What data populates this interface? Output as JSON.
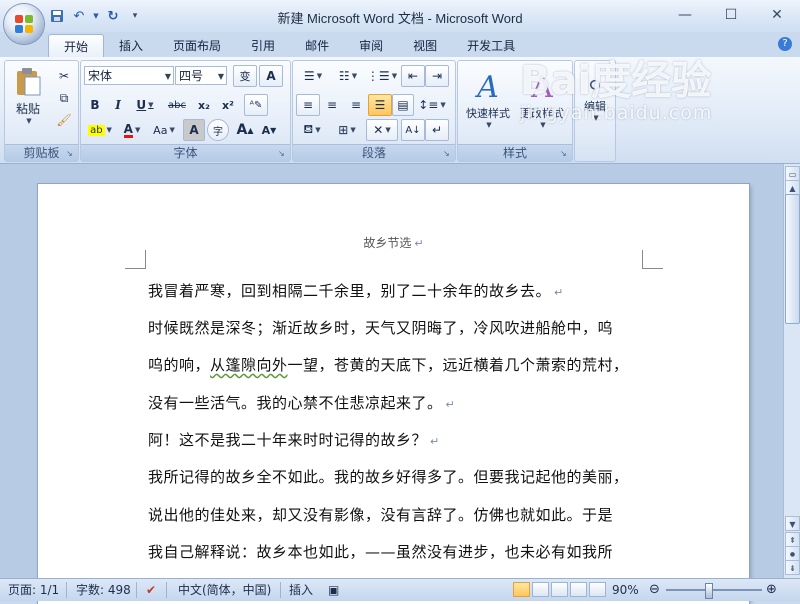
{
  "window": {
    "title": "新建 Microsoft Word 文档 - Microsoft Word",
    "controls": [
      "minimize",
      "maximize",
      "close"
    ]
  },
  "quick_access": {
    "icons": [
      "save-icon",
      "undo-icon",
      "redo-icon",
      "customize-icon"
    ]
  },
  "tabs": [
    {
      "label": "开始",
      "active": true
    },
    {
      "label": "插入"
    },
    {
      "label": "页面布局"
    },
    {
      "label": "引用"
    },
    {
      "label": "邮件"
    },
    {
      "label": "审阅"
    },
    {
      "label": "视图"
    },
    {
      "label": "开发工具"
    }
  ],
  "ribbon": {
    "clipboard": {
      "label": "剪贴板",
      "paste": "粘贴"
    },
    "font": {
      "label": "字体",
      "font_name": "宋体",
      "font_size": "四号",
      "wen_btn": "变",
      "a_btn": "A",
      "bold": "B",
      "italic": "I",
      "underline": "U",
      "strike": "abc",
      "sub": "x₂",
      "sup": "x²",
      "case": "Aa",
      "grow": "A",
      "shrink": "A",
      "char_border": "A",
      "enclose": "字"
    },
    "paragraph": {
      "label": "段落"
    },
    "styles": {
      "label": "样式",
      "quick": "快速样式",
      "change": "更改样式"
    },
    "editing": {
      "label": "编辑"
    }
  },
  "document": {
    "header": "故乡节选",
    "lines": [
      {
        "text": "我冒着严寒，回到相隔二千余里，别了二十余年的故乡去。",
        "mark": true
      },
      {
        "text": "时候既然是深冬；渐近故乡时，天气又阴晦了，冷风吹进船舱中，呜",
        "mark": false
      },
      {
        "pre": "呜的响，",
        "squig": "从篷隙向外",
        "post": "一望，苍黄的天底下，远近横着几个萧索的荒村，",
        "mark": false
      },
      {
        "text": "没有一些活气。我的心禁不住悲凉起来了。",
        "mark": true
      },
      {
        "text": "阿！这不是我二十年来时时记得的故乡？",
        "mark": true
      },
      {
        "text": "我所记得的故乡全不如此。我的故乡好得多了。但要我记起他的美丽，",
        "mark": false
      },
      {
        "text": "说出他的佳处来，却又没有影像，没有言辞了。仿佛也就如此。于是",
        "mark": false
      },
      {
        "text": "我自己解释说：故乡本也如此，——虽然没有进步，也未必有如我所",
        "mark": false
      }
    ],
    "pilcrow": "↵"
  },
  "status": {
    "page": "页面: 1/1",
    "words": "字数: 498",
    "language": "中文(简体，中国)",
    "insert": "插入",
    "zoom": "90%",
    "zoom_fraction": 0.45
  },
  "watermark": {
    "brand": "Bai度经验",
    "url": "jingyan.baidu.com"
  }
}
